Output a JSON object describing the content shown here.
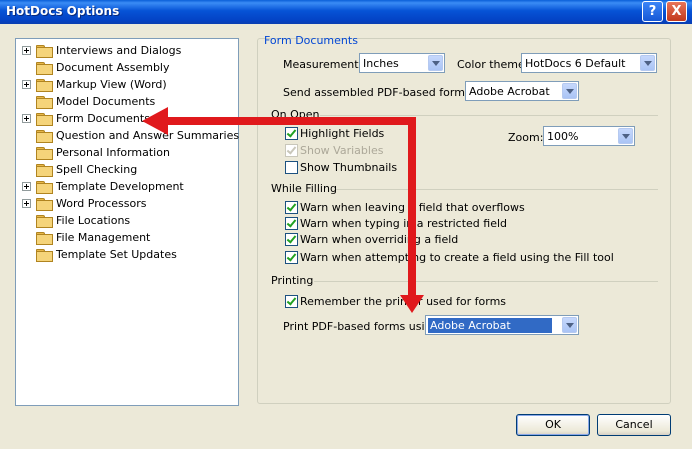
{
  "window": {
    "title": "HotDocs Options"
  },
  "tree": {
    "items": [
      {
        "label": "Interviews and Dialogs",
        "expandable": true
      },
      {
        "label": "Document Assembly",
        "expandable": false
      },
      {
        "label": "Markup View (Word)",
        "expandable": true
      },
      {
        "label": "Model Documents",
        "expandable": false
      },
      {
        "label": "Form Documents",
        "expandable": true
      },
      {
        "label": "Question and Answer Summaries",
        "expandable": false
      },
      {
        "label": "Personal Information",
        "expandable": false
      },
      {
        "label": "Spell Checking",
        "expandable": false
      },
      {
        "label": "Template Development",
        "expandable": true
      },
      {
        "label": "Word Processors",
        "expandable": true
      },
      {
        "label": "File Locations",
        "expandable": false
      },
      {
        "label": "File Management",
        "expandable": false
      },
      {
        "label": "Template Set Updates",
        "expandable": false
      }
    ]
  },
  "form_documents": {
    "title": "Form Documents",
    "measurements_label": "Measurements:",
    "measurements_value": "Inches",
    "color_theme_label": "Color theme:",
    "color_theme_value": "HotDocs 6 Default",
    "send_label": "Send assembled PDF-based forms to:",
    "send_value": "Adobe Acrobat"
  },
  "on_open": {
    "title": "On Open",
    "highlight_fields": "Highlight Fields",
    "show_variables": "Show Variables",
    "show_thumbnails": "Show Thumbnails",
    "zoom_label": "Zoom:",
    "zoom_value": "100%"
  },
  "while_filling": {
    "title": "While Filling",
    "opt1": "Warn when leaving a field that overflows",
    "opt2": "Warn when typing in a restricted field",
    "opt3": "Warn when overriding a field",
    "opt4": "Warn when attempting to create a field using the Fill tool"
  },
  "printing": {
    "title": "Printing",
    "remember": "Remember the printer used for forms",
    "print_label": "Print PDF-based forms using:",
    "print_value": "Adobe Acrobat"
  },
  "buttons": {
    "ok": "OK",
    "cancel": "Cancel"
  },
  "titlebar": {
    "help": "?",
    "close": "X"
  },
  "colors": {
    "arrow": "#e0191c",
    "title_bar": "#0653d6",
    "group_title": "#0046d5"
  }
}
